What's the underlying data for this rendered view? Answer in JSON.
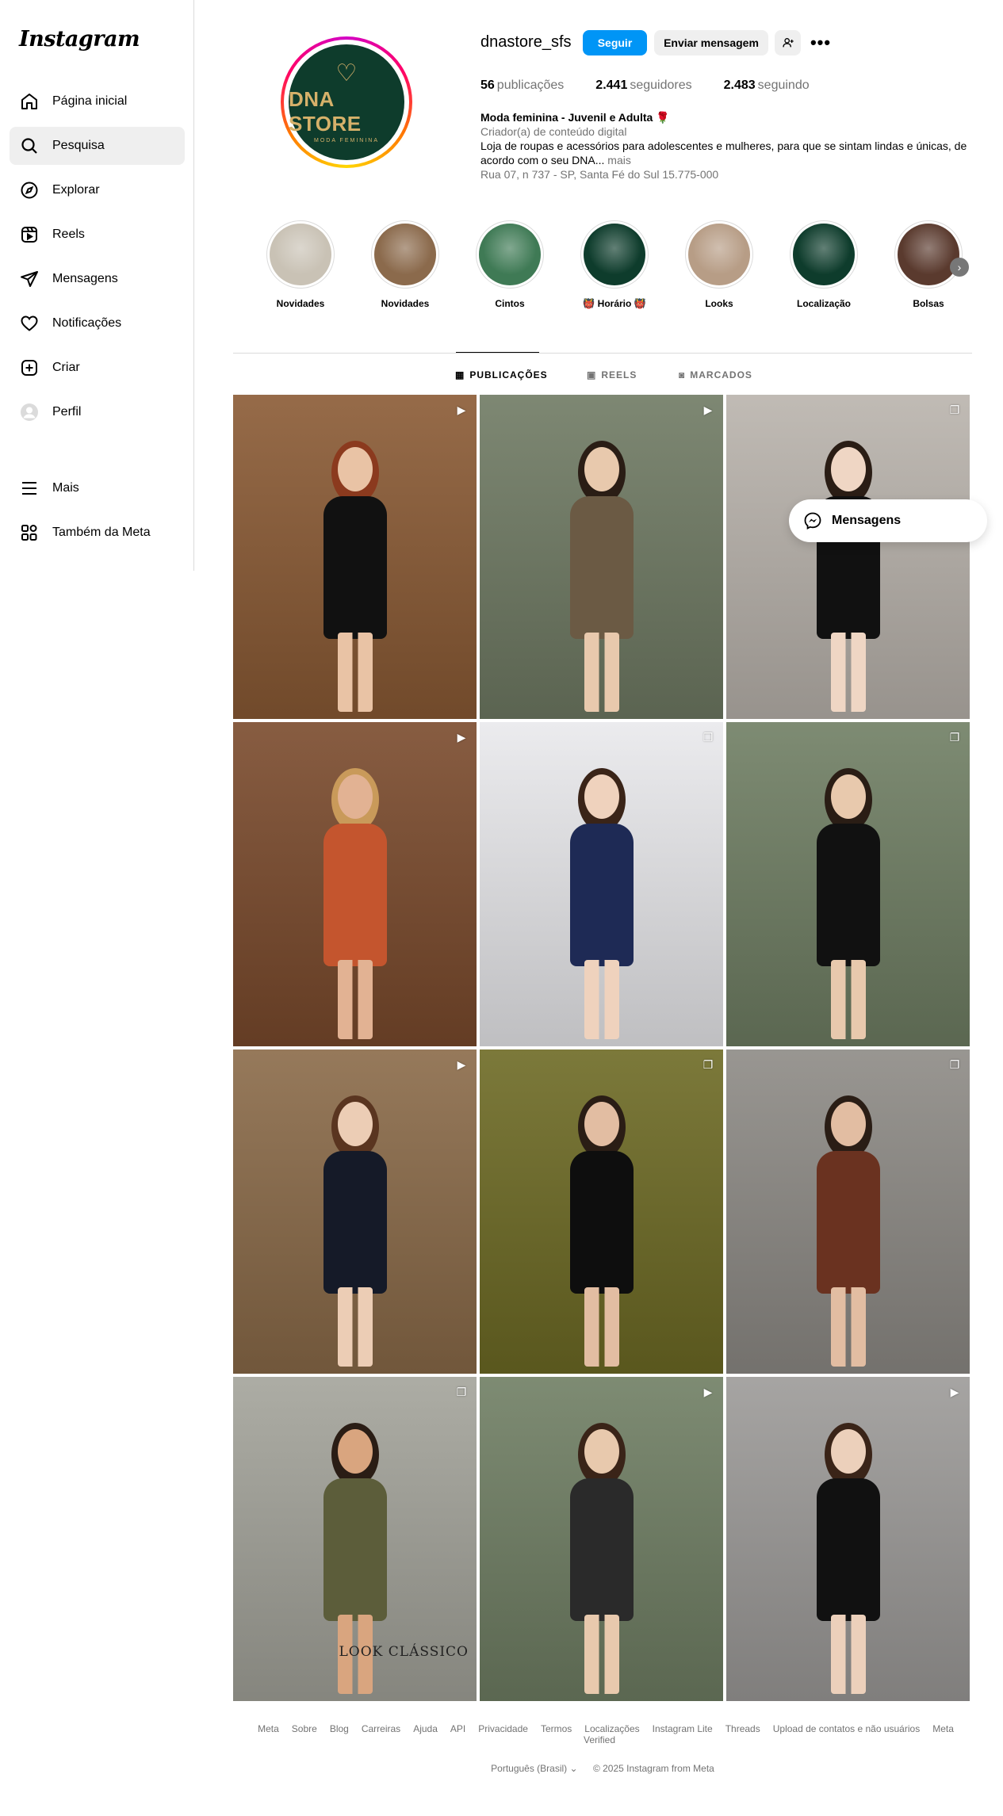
{
  "sidebar": {
    "logo": "Instagram",
    "items": [
      {
        "label": "Página inicial"
      },
      {
        "label": "Pesquisa"
      },
      {
        "label": "Explorar"
      },
      {
        "label": "Reels"
      },
      {
        "label": "Mensagens"
      },
      {
        "label": "Notificações"
      },
      {
        "label": "Criar"
      },
      {
        "label": "Perfil"
      }
    ],
    "bottom": [
      {
        "label": "Mais"
      },
      {
        "label": "Também da Meta"
      }
    ]
  },
  "profile": {
    "avatar_brand": "DNA STORE",
    "avatar_sub": "MODA FEMININA",
    "username": "dnastore_sfs",
    "follow_label": "Seguir",
    "message_label": "Enviar mensagem",
    "stats": {
      "posts_count": "56",
      "posts_label": "publicações",
      "followers_count": "2.441",
      "followers_label": "seguidores",
      "following_count": "2.483",
      "following_label": "seguindo"
    },
    "bio_name": "Moda feminina - Juvenil e Adulta 🌹",
    "bio_category": "Criador(a) de conteúdo digital",
    "bio_text": "Loja de roupas e acessórios para adolescentes e mulheres, para que se sintam lindas e únicas, de acordo com o seu DNA...",
    "bio_more": "mais",
    "bio_address": "Rua 07, n 737 - SP, Santa Fé do Sul 15.775-000"
  },
  "highlights": [
    {
      "label": "Novidades",
      "color": "#c9c2b5"
    },
    {
      "label": "Novidades",
      "color": "#8b6a4c"
    },
    {
      "label": "Cintos",
      "color": "#3f7a55"
    },
    {
      "label": "👹 Horário 👹",
      "color": "#0e3c2c"
    },
    {
      "label": "Looks",
      "color": "#b79d86"
    },
    {
      "label": "Localização",
      "color": "#0e3c2c"
    },
    {
      "label": "Bolsas",
      "color": "#5a3a2e"
    }
  ],
  "tabs": [
    {
      "label": "PUBLICAÇÕES",
      "icon": "grid-icon"
    },
    {
      "label": "REELS",
      "icon": "reels-icon"
    },
    {
      "label": "MARCADOS",
      "icon": "tagged-icon"
    }
  ],
  "posts": [
    {
      "type": "reel",
      "bg": "#8a5a34",
      "outfit": "#111111",
      "skin": "#e9c3a5",
      "hair": "#8b3a1e"
    },
    {
      "type": "reel",
      "bg": "#6f7a63",
      "outfit": "#6b5a44",
      "skin": "#e8c9ad",
      "hair": "#2a1d15"
    },
    {
      "type": "carousel",
      "bg": "#b9b3ac",
      "outfit": "#111111",
      "skin": "#efd6c4",
      "hair": "#2a1d15"
    },
    {
      "type": "reel",
      "bg": "#7a4a2c",
      "outfit": "#c4552e",
      "skin": "#e2b293",
      "hair": "#c99a5a"
    },
    {
      "type": "carousel",
      "bg": "#e9e9ec",
      "outfit": "#1e2a55",
      "skin": "#efd2bd",
      "hair": "#3a2418"
    },
    {
      "type": "carousel",
      "bg": "#6f7e63",
      "outfit": "#111111",
      "skin": "#e8c9ad",
      "hair": "#2a1d15"
    },
    {
      "type": "reel",
      "bg": "#8a6a48",
      "outfit": "#151a28",
      "skin": "#eccdb5",
      "hair": "#5a3520"
    },
    {
      "type": "carousel",
      "bg": "#6d6a24",
      "outfit": "#0e0e0e",
      "skin": "#e2bda2",
      "hair": "#2a1d15"
    },
    {
      "type": "carousel",
      "bg": "#8d8a85",
      "outfit": "#6a3220",
      "skin": "#e2bda2",
      "hair": "#2a1d15"
    },
    {
      "type": "carousel",
      "bg": "#a3a39a",
      "outfit": "#5c5d3a",
      "skin": "#d9a57f",
      "hair": "#2a1d15",
      "overlay": "LOOK CLÁSSICO"
    },
    {
      "type": "reel",
      "bg": "#6f7e63",
      "outfit": "#2a2a2a",
      "skin": "#e8c9ad",
      "hair": "#3a2418"
    },
    {
      "type": "reel",
      "bg": "#9c9a98",
      "outfit": "#111111",
      "skin": "#ecd0bb",
      "hair": "#3a2418"
    }
  ],
  "floating": {
    "label": "Mensagens"
  },
  "footer": {
    "links": [
      "Meta",
      "Sobre",
      "Blog",
      "Carreiras",
      "Ajuda",
      "API",
      "Privacidade",
      "Termos",
      "Localizações",
      "Instagram Lite",
      "Threads",
      "Upload de contatos e não usuários",
      "Meta Verified"
    ],
    "language": "Português (Brasil)",
    "copyright": "© 2025 Instagram from Meta"
  }
}
